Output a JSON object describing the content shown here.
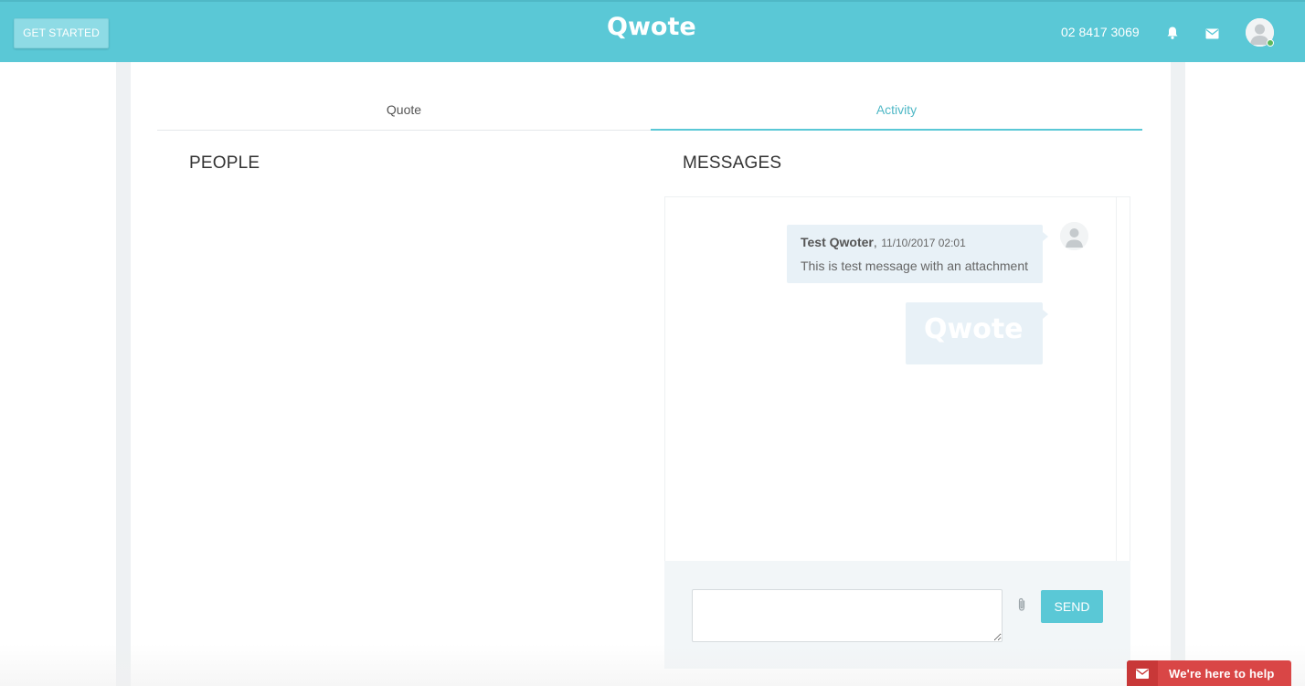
{
  "header": {
    "get_started_label": "GET STARTED",
    "logo_text": "Qwote",
    "phone": "02 8417 3069",
    "icons": [
      "bell-icon",
      "mail-icon",
      "user-avatar-icon"
    ],
    "accent_color": "#5ac8d6"
  },
  "tabs": [
    {
      "label": "Quote",
      "active": false
    },
    {
      "label": "Activity",
      "active": true
    }
  ],
  "people": {
    "title": "PEOPLE"
  },
  "messages": {
    "title": "MESSAGES",
    "items": [
      {
        "author": "Test Qwoter",
        "separator": ",",
        "timestamp": "11/10/2017 02:01",
        "text": "This is test message with an attachment",
        "attachment_logo_text": "Qwote"
      }
    ]
  },
  "composer": {
    "message_value": "",
    "send_label": "SEND",
    "attach_icon": "paperclip-icon"
  },
  "help_widget": {
    "label": "We're here to help",
    "color": "#d94646"
  }
}
